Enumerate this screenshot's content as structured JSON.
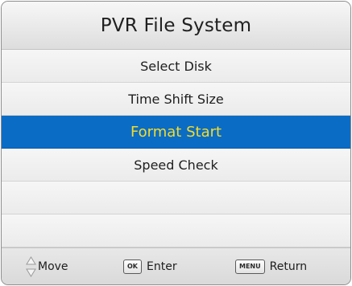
{
  "title": "PVR File System",
  "menu": {
    "items": [
      {
        "label": "Select Disk"
      },
      {
        "label": "Time Shift Size"
      },
      {
        "label": "Format Start",
        "selected": true
      },
      {
        "label": "Speed Check"
      },
      {
        "label": ""
      },
      {
        "label": ""
      }
    ]
  },
  "footer": {
    "move": {
      "icon": "up-down-arrows-icon",
      "label": "Move"
    },
    "enter": {
      "key": "OK",
      "label": "Enter"
    },
    "return": {
      "key": "MENU",
      "label": "Return"
    }
  },
  "colors": {
    "selected_background": "#0a6cc5",
    "selected_text": "#f5dc2a"
  }
}
